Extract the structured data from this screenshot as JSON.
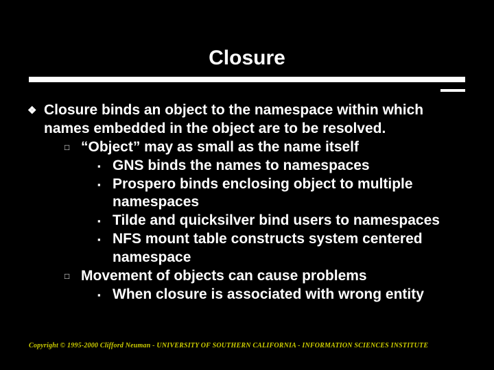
{
  "title": "Closure",
  "body": {
    "p1": "Closure binds an object to the namespace within which names embedded in the object are to be resolved.",
    "p2": "“Object” may as small as the name itself",
    "p2a": "GNS binds the names to namespaces",
    "p2b": "Prospero binds enclosing object to multiple namespaces",
    "p2c": "Tilde and quicksilver bind users to namespaces",
    "p2d": "NFS mount table constructs system centered namespace",
    "p3": "Movement of objects can cause problems",
    "p3a": "When closure is associated with wrong entity"
  },
  "bullets": {
    "diamond": "❖",
    "hollow_square": "□",
    "filled_square": "▪"
  },
  "footer": "Copyright © 1995-2000 Clifford Neuman - UNIVERSITY OF SOUTHERN CALIFORNIA - INFORMATION SCIENCES INSTITUTE"
}
